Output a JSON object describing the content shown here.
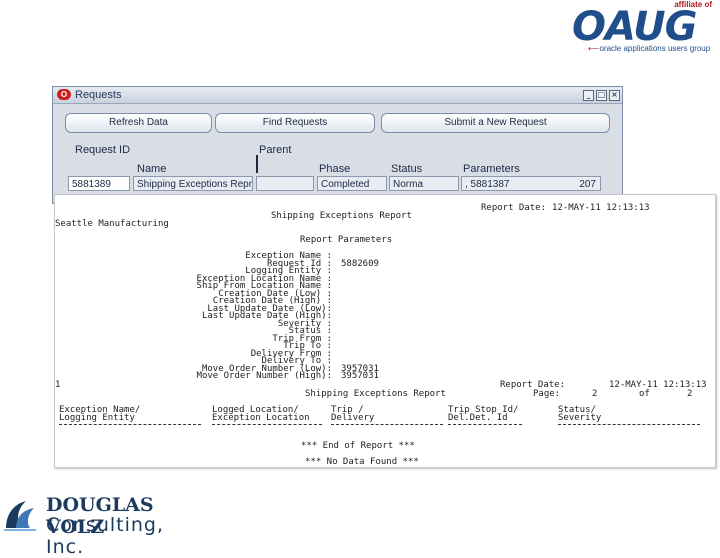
{
  "oaug_logo": {
    "affiliate": "affiliate of",
    "wordmark": "OAUG",
    "tagline": "oracle applications users group"
  },
  "window": {
    "title": "Requests",
    "buttons": {
      "refresh": "Refresh Data",
      "find": "Find Requests",
      "submit": "Submit a New Request"
    },
    "columns": {
      "request_id": "Request ID",
      "name": "Name",
      "parent": "Parent",
      "phase": "Phase",
      "status": "Status",
      "parameters": "Parameters"
    },
    "row": {
      "request_id": "5881389",
      "name": "Shipping Exceptions Repr",
      "parent": "",
      "phase": "Completed",
      "status": "Norma",
      "parameters": ", 5881387",
      "param_extra": "207"
    }
  },
  "report": {
    "date_label": "Report Date:",
    "date_value": "12-MAY-11 12:13:13",
    "title": "Shipping Exceptions Report",
    "org": "Seattle Manufacturing",
    "params_heading": "Report Parameters",
    "params": [
      {
        "label": "Exception Name :",
        "value": ""
      },
      {
        "label": "Request Id :",
        "value": "5882609"
      },
      {
        "label": "Logging Entity :",
        "value": ""
      },
      {
        "label": "Exception Location Name :",
        "value": ""
      },
      {
        "label": "Ship From Location Name :",
        "value": ""
      },
      {
        "label": "Creation Date (Low) :",
        "value": ""
      },
      {
        "label": "Creation Date (High) :",
        "value": ""
      },
      {
        "label": "Last Update Date (Low):",
        "value": ""
      },
      {
        "label": "Last Update Date (High):",
        "value": ""
      },
      {
        "label": "Severity :",
        "value": ""
      },
      {
        "label": "Status :",
        "value": ""
      },
      {
        "label": "Trip From :",
        "value": ""
      },
      {
        "label": "Trip To :",
        "value": ""
      },
      {
        "label": "Delivery From :",
        "value": ""
      },
      {
        "label": "Delivery To :",
        "value": ""
      },
      {
        "label": "Move Order Number (Low):",
        "value": "3957031"
      },
      {
        "label": "Move Order Number (High):",
        "value": "3957031"
      }
    ],
    "page_marker": "1",
    "page2_date_label": "Report Date:",
    "page2_date_value": "12-MAY-11 12:13:13",
    "page_label": "Page:",
    "page_num": "2",
    "page_of": "of",
    "page_total": "2",
    "col_headers": [
      {
        "l1": "Exception Name/",
        "l2": "Logging Entity"
      },
      {
        "l1": "Logged Location/",
        "l2": "Exception Location"
      },
      {
        "l1": "Trip /",
        "l2": "Delivery"
      },
      {
        "l1": "Trip Stop Id/",
        "l2": "Del.Det. Id"
      },
      {
        "l1": "Status/",
        "l2": "Severity"
      }
    ],
    "end_of_report": "*** End of Report ***",
    "no_data": "*** No Data Found ***"
  },
  "dv_logo": {
    "line1": "DOUGLAS VOLZ",
    "line2": "Consulting, Inc."
  }
}
